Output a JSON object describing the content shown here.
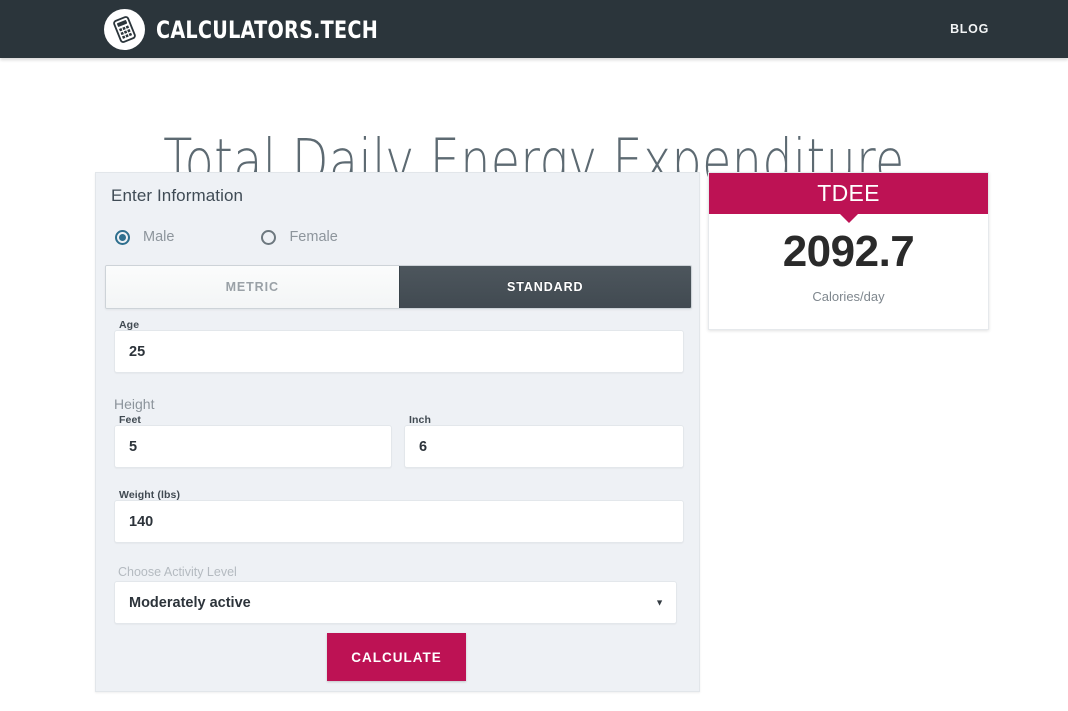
{
  "navbar": {
    "brand_name": "CALCULATORS.TECH",
    "logo_icon": "calculator-icon",
    "links": [
      {
        "label": "BLOG"
      }
    ]
  },
  "page": {
    "title": "Total Daily Energy Expenditure"
  },
  "form": {
    "heading": "Enter Information",
    "gender": {
      "selected": "Male",
      "options": [
        {
          "label": "Male",
          "checked": true
        },
        {
          "label": "Female",
          "checked": false
        }
      ]
    },
    "units": {
      "active": "STANDARD",
      "tabs": [
        {
          "label": "METRIC",
          "active": false
        },
        {
          "label": "STANDARD",
          "active": true
        }
      ]
    },
    "age": {
      "label": "Age",
      "value": "25",
      "placeholder": "Age"
    },
    "height": {
      "caption": "Height",
      "feet": {
        "label": "Feet",
        "value": "5",
        "placeholder": "Feet"
      },
      "inch": {
        "label": "Inch",
        "value": "6",
        "placeholder": "Inch"
      }
    },
    "weight": {
      "label": "Weight (lbs)",
      "value": "140",
      "placeholder": "Weight (lbs)"
    },
    "activity": {
      "caption": "Choose Activity Level",
      "selected": "Moderately active",
      "caret_icon": "chevron-down-icon"
    },
    "submit": {
      "label": "CALCULATE"
    }
  },
  "result": {
    "title": "TDEE",
    "value": "2092.7",
    "unit": "Calories/day"
  },
  "colors": {
    "navbar_bg": "#2b353b",
    "accent": "#bd1254",
    "panel_bg": "#eef1f5",
    "tab_active_bg": "#414a51",
    "radio_checked": "#2e6f8e",
    "title_text": "#5d6a72"
  }
}
